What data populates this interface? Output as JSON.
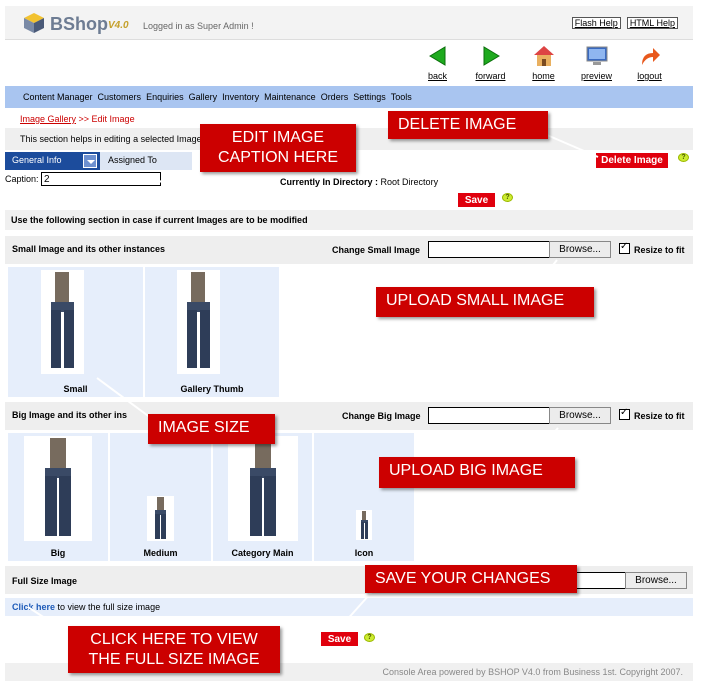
{
  "header": {
    "app_name": "BShop",
    "version": "V4.0",
    "logged_in": "Logged in as Super Admin !",
    "flash_help": "Flash Help",
    "html_help": "HTML Help"
  },
  "toolbar": {
    "back": "back",
    "forward": "forward",
    "home": "home",
    "preview": "preview",
    "logout": "logout"
  },
  "menu": [
    "Content Manager",
    "Customers",
    "Enquiries",
    "Gallery",
    "Inventory",
    "Maintenance",
    "Orders",
    "Settings",
    "Tools"
  ],
  "breadcrumb": {
    "link": "Image Gallery",
    "sep": " >> ",
    "current": "Edit Image"
  },
  "description": "This section helps in editing a selected Image",
  "tabs": {
    "general": "General Info",
    "assigned": "Assigned To"
  },
  "caption": {
    "label": "Caption:",
    "value": "2"
  },
  "directory": {
    "label": "Currently In Directory :",
    "value": "Root Directory"
  },
  "buttons": {
    "delete_image": "Delete Image",
    "save": "Save",
    "help": "?",
    "browse": "Browse..."
  },
  "modify_note": "Use the following section in case if current Images are to be modified",
  "small_section": {
    "title": "Small Image and its other instances",
    "change_label": "Change Small Image",
    "resize": "Resize to fit",
    "images": [
      "Small",
      "Gallery Thumb"
    ]
  },
  "big_section": {
    "title": "Big Image and its other ins",
    "change_label": "Change Big Image",
    "resize": "Resize to fit",
    "images": [
      "Big",
      "Medium",
      "Category Main",
      "Icon"
    ]
  },
  "full_section": {
    "title": "Full Size Image",
    "click_here": "Click here",
    "click_text": " to view the full size image"
  },
  "callouts": {
    "edit_caption_1": "EDIT IMAGE",
    "edit_caption_2": "CAPTION HERE",
    "delete": "DELETE IMAGE",
    "upload_small": "UPLOAD SMALL IMAGE",
    "image_size": "IMAGE SIZE",
    "upload_big": "UPLOAD BIG IMAGE",
    "save_changes": "SAVE YOUR CHANGES",
    "view_full_1": "CLICK HERE TO VIEW",
    "view_full_2": "THE FULL SIZE IMAGE"
  },
  "footer": "Console Area powered by BSHOP V4.0 from Business 1st. Copyright 2007.",
  "colors": {
    "menubar": "#a9c5f0",
    "red": "#e0000d",
    "callout": "#cc0000",
    "tab_active": "#1c4c9c"
  }
}
